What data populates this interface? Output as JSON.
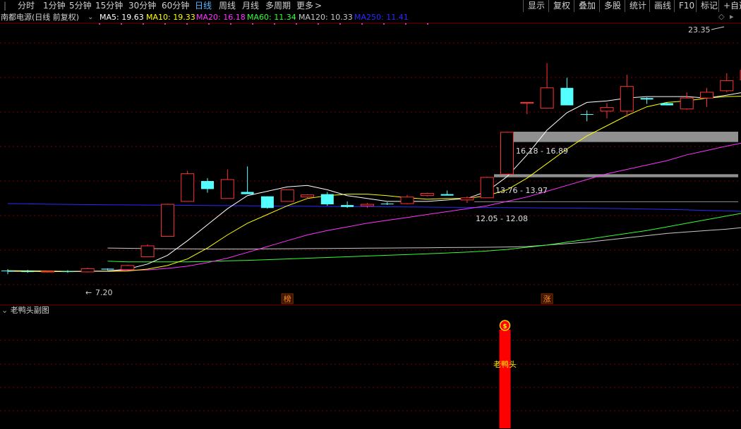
{
  "toolbar": {
    "periods": [
      "分时",
      "1分钟",
      "5分钟",
      "15分钟",
      "30分钟",
      "60分钟",
      "日线",
      "周线",
      "月线",
      "多周期",
      "更多"
    ],
    "more_arrow": ">",
    "active_index": 6,
    "right_buttons": [
      "显示",
      "复权",
      "叠加",
      "多股",
      "统计",
      "画线",
      "F10",
      "标记",
      "+自选"
    ]
  },
  "infobar": {
    "stock_title": "南都电源(日线 前复权)",
    "ma": [
      {
        "label": "MA5: 19.63",
        "color": "#ffffff"
      },
      {
        "label": "MA10: 19.33",
        "color": "#ffff00"
      },
      {
        "label": "MA20: 16.18",
        "color": "#ff33ff"
      },
      {
        "label": "MA60: 11.34",
        "color": "#33ff33"
      },
      {
        "label": "MA120: 10.33",
        "color": "#c8c8c8"
      },
      {
        "label": "MA250: 11.41",
        "color": "#2a2aff"
      }
    ]
  },
  "annotations": {
    "high": "23.35",
    "low": "7.20",
    "zone_top": "16.18 - 16.89",
    "zone_mid": "13.76 - 13.97",
    "zone_low": "12.05 - 12.08",
    "marker_bang": "榜",
    "marker_zhang": "涨"
  },
  "subchart": {
    "title": "老鸭头副图",
    "signal_text": "老鸭头",
    "signal_icon": "$"
  },
  "colors": {
    "up": "#ff3232",
    "down": "#54ffff",
    "grid": "#7a0000",
    "ma5": "#ffffff",
    "ma10": "#ffff00",
    "ma20": "#ff33ff",
    "ma60": "#33ff33",
    "ma120": "#c8c8c8",
    "ma250": "#2a2aff"
  },
  "chart_data": {
    "type": "candlestick",
    "y_range": [
      6,
      24
    ],
    "candles": [
      {
        "o": 7.35,
        "h": 7.45,
        "l": 7.1,
        "c": 7.3
      },
      {
        "o": 7.3,
        "h": 7.4,
        "l": 7.2,
        "c": 7.25
      },
      {
        "o": 7.25,
        "h": 7.35,
        "l": 7.2,
        "c": 7.3
      },
      {
        "o": 7.3,
        "h": 7.38,
        "l": 7.2,
        "c": 7.26
      },
      {
        "o": 7.26,
        "h": 7.55,
        "l": 7.22,
        "c": 7.48
      },
      {
        "o": 7.48,
        "h": 7.5,
        "l": 7.38,
        "c": 7.42
      },
      {
        "o": 7.42,
        "h": 7.75,
        "l": 7.38,
        "c": 7.7
      },
      {
        "o": 8.3,
        "h": 9.15,
        "l": 8.3,
        "c": 9.05
      },
      {
        "o": 9.7,
        "h": 11.95,
        "l": 9.7,
        "c": 11.9
      },
      {
        "o": 12.1,
        "h": 14.2,
        "l": 12.1,
        "c": 14.0
      },
      {
        "o": 13.5,
        "h": 13.7,
        "l": 12.7,
        "c": 12.95
      },
      {
        "o": 12.3,
        "h": 14.3,
        "l": 12.3,
        "c": 13.6
      },
      {
        "o": 12.75,
        "h": 14.5,
        "l": 12.6,
        "c": 12.6
      },
      {
        "o": 12.45,
        "h": 12.45,
        "l": 11.6,
        "c": 11.65
      },
      {
        "o": 12.1,
        "h": 12.9,
        "l": 12.1,
        "c": 12.9
      },
      {
        "o": 12.4,
        "h": 12.6,
        "l": 12.3,
        "c": 12.55
      },
      {
        "o": 12.6,
        "h": 12.75,
        "l": 11.8,
        "c": 11.9
      },
      {
        "o": 11.85,
        "h": 12.1,
        "l": 11.65,
        "c": 11.72
      },
      {
        "o": 11.8,
        "h": 12.0,
        "l": 11.65,
        "c": 11.9
      },
      {
        "o": 11.95,
        "h": 12.05,
        "l": 11.85,
        "c": 11.9
      },
      {
        "o": 11.95,
        "h": 12.55,
        "l": 11.9,
        "c": 12.4
      },
      {
        "o": 12.5,
        "h": 12.7,
        "l": 12.45,
        "c": 12.65
      },
      {
        "o": 12.6,
        "h": 12.85,
        "l": 12.5,
        "c": 12.5
      },
      {
        "o": 12.2,
        "h": 12.45,
        "l": 12.0,
        "c": 12.35
      },
      {
        "o": 12.35,
        "h": 13.8,
        "l": 12.35,
        "c": 13.75
      },
      {
        "o": 13.97,
        "h": 16.89,
        "l": 13.95,
        "c": 16.85
      },
      {
        "o": 18.9,
        "h": 18.9,
        "l": 18.1,
        "c": 18.9
      },
      {
        "o": 18.5,
        "h": 21.6,
        "l": 18.5,
        "c": 19.9
      },
      {
        "o": 19.9,
        "h": 20.6,
        "l": 18.7,
        "c": 18.7
      },
      {
        "o": 18.1,
        "h": 18.35,
        "l": 17.6,
        "c": 18.05
      },
      {
        "o": 18.3,
        "h": 18.85,
        "l": 17.8,
        "c": 18.55
      },
      {
        "o": 18.3,
        "h": 20.8,
        "l": 17.9,
        "c": 20.0
      },
      {
        "o": 19.2,
        "h": 19.25,
        "l": 18.8,
        "c": 19.1
      },
      {
        "o": 18.85,
        "h": 18.9,
        "l": 18.7,
        "c": 18.7
      },
      {
        "o": 18.45,
        "h": 19.6,
        "l": 18.4,
        "c": 19.2
      },
      {
        "o": 19.2,
        "h": 19.9,
        "l": 18.6,
        "c": 19.6
      },
      {
        "o": 19.7,
        "h": 20.9,
        "l": 19.6,
        "c": 20.4
      },
      {
        "o": 20.45,
        "h": 23.35,
        "l": 20.4,
        "c": 21.1
      }
    ],
    "ma5": [
      7.3,
      7.3,
      7.28,
      7.28,
      7.3,
      7.32,
      7.45,
      7.8,
      8.4,
      9.4,
      10.5,
      11.6,
      12.5,
      12.8,
      13.1,
      13.2,
      12.9,
      12.5,
      12.3,
      12.1,
      12.1,
      12.1,
      12.2,
      12.3,
      12.8,
      13.8,
      15.3,
      17.0,
      18.2,
      18.9,
      19.0,
      19.2,
      19.3,
      19.3,
      19.3,
      19.2,
      19.4,
      19.63
    ],
    "ma10": [
      7.35,
      7.33,
      7.32,
      7.3,
      7.3,
      7.3,
      7.32,
      7.45,
      7.7,
      8.15,
      8.9,
      9.8,
      10.6,
      11.2,
      11.8,
      12.3,
      12.5,
      12.6,
      12.6,
      12.5,
      12.35,
      12.25,
      12.3,
      12.3,
      12.5,
      12.9,
      13.7,
      14.7,
      15.7,
      16.6,
      17.3,
      18.0,
      18.6,
      18.9,
      19.0,
      19.2,
      19.3,
      19.33
    ],
    "ma20": [
      null,
      null,
      null,
      null,
      null,
      7.35,
      7.36,
      7.4,
      7.5,
      7.65,
      7.9,
      8.2,
      8.6,
      9.0,
      9.4,
      9.8,
      10.1,
      10.35,
      10.6,
      10.8,
      11.0,
      11.2,
      11.4,
      11.6,
      11.8,
      12.1,
      12.4,
      12.8,
      13.2,
      13.6,
      14.0,
      14.3,
      14.6,
      14.9,
      15.3,
      15.6,
      15.9,
      16.18
    ],
    "ma60": [
      null,
      null,
      null,
      null,
      null,
      8.0,
      7.95,
      7.95,
      7.95,
      7.95,
      7.98,
      8.02,
      8.05,
      8.1,
      8.15,
      8.2,
      8.25,
      8.3,
      8.35,
      8.4,
      8.45,
      8.5,
      8.56,
      8.62,
      8.7,
      8.8,
      8.95,
      9.1,
      9.3,
      9.5,
      9.7,
      9.9,
      10.1,
      10.35,
      10.6,
      10.85,
      11.1,
      11.34
    ],
    "ma120": [
      null,
      null,
      null,
      null,
      null,
      8.9,
      8.88,
      8.86,
      8.85,
      8.84,
      8.83,
      8.83,
      8.83,
      8.84,
      8.85,
      8.86,
      8.87,
      8.88,
      8.89,
      8.9,
      8.91,
      8.92,
      8.93,
      8.94,
      8.95,
      8.97,
      9.0,
      9.1,
      9.2,
      9.3,
      9.45,
      9.6,
      9.75,
      9.9,
      10.0,
      10.1,
      10.2,
      10.33
    ],
    "ma250": [
      11.95,
      11.93,
      11.91,
      11.9,
      11.88,
      11.87,
      11.86,
      11.85,
      11.84,
      11.83,
      11.82,
      11.81,
      11.8,
      11.79,
      11.78,
      11.77,
      11.76,
      11.75,
      11.74,
      11.73,
      11.72,
      11.71,
      11.7,
      11.69,
      11.68,
      11.67,
      11.66,
      11.65,
      11.64,
      11.63,
      11.62,
      11.6,
      11.58,
      11.55,
      11.52,
      11.48,
      11.45,
      11.41
    ],
    "marker_bang_index": 14,
    "marker_zhang_index": 27,
    "signal_index": 25
  }
}
